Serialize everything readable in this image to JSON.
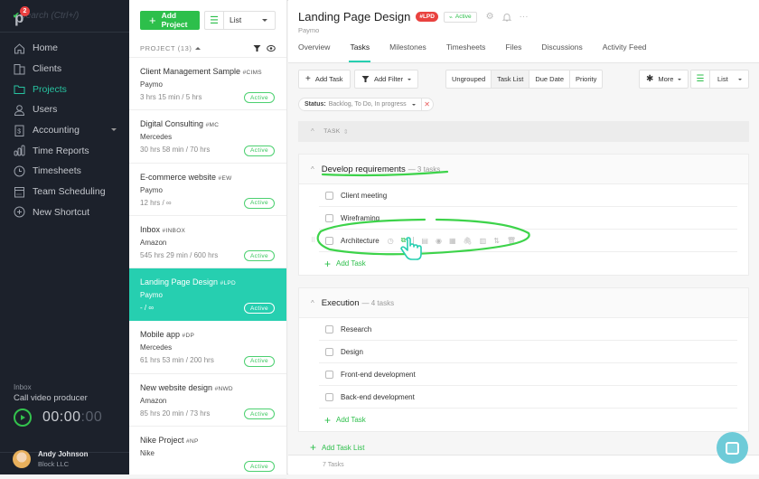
{
  "sidebar": {
    "logo": "paymo-logo",
    "notification_count": "2",
    "search_placeholder": "Search (Ctrl+/)",
    "nav": [
      {
        "label": "Home",
        "icon": "home-icon"
      },
      {
        "label": "Clients",
        "icon": "clients-icon"
      },
      {
        "label": "Projects",
        "icon": "folder-icon",
        "active": true
      },
      {
        "label": "Users",
        "icon": "user-icon"
      },
      {
        "label": "Accounting",
        "icon": "accounting-icon",
        "has_dropdown": true
      },
      {
        "label": "Time Reports",
        "icon": "bar-chart-icon"
      },
      {
        "label": "Timesheets",
        "icon": "clock-icon"
      },
      {
        "label": "Team Scheduling",
        "icon": "calendar-icon"
      },
      {
        "label": "New Shortcut",
        "icon": "plus-circle-icon"
      }
    ],
    "timer": {
      "context": "Inbox",
      "task": "Call video producer",
      "time_main": "00:00",
      "time_dim": ":00"
    },
    "user": {
      "name": "Andy Johnson",
      "company": "Block LLC"
    }
  },
  "projects": {
    "add_label": "Add Project",
    "view_label": "List",
    "header": "PROJECT (13)",
    "items": [
      {
        "name": "Client Management Sample",
        "code": "#CIMS",
        "client": "Paymo",
        "time": "3 hrs 15 min / 5 hrs",
        "status": "Active"
      },
      {
        "name": "Digital Consulting",
        "code": "#MC",
        "client": "Mercedes",
        "time": "30 hrs 58 min / 70 hrs",
        "status": "Active"
      },
      {
        "name": "E-commerce website",
        "code": "#EW",
        "client": "Paymo",
        "time": "12 hrs / ∞",
        "status": "Active"
      },
      {
        "name": "Inbox",
        "code": "#INBOX",
        "client": "Amazon",
        "time": "545 hrs 29 min / 600 hrs",
        "status": "Active"
      },
      {
        "name": "Landing Page Design",
        "code": "#LPD",
        "client": "Paymo",
        "time": "- / ∞",
        "status": "Active",
        "selected": true
      },
      {
        "name": "Mobile app",
        "code": "#DP",
        "client": "Mercedes",
        "time": "61 hrs 53 min / 200 hrs",
        "status": "Active"
      },
      {
        "name": "New website design",
        "code": "#NWD",
        "client": "Amazon",
        "time": "85 hrs 20 min / 73 hrs",
        "status": "Active"
      },
      {
        "name": "Nike Project",
        "code": "#NP",
        "client": "Nike",
        "time": "",
        "status": "Active"
      }
    ]
  },
  "main": {
    "title": "Landing Page Design",
    "code": "#LPD",
    "status": "Active",
    "client": "Paymo",
    "tabs": [
      "Overview",
      "Tasks",
      "Milestones",
      "Timesheets",
      "Files",
      "Discussions",
      "Activity Feed"
    ],
    "active_tab": "Tasks",
    "toolbar": {
      "add_task": "Add Task",
      "add_filter": "Add Filter",
      "grouping": [
        "Ungrouped",
        "Task List",
        "Due Date",
        "Priority"
      ],
      "grouping_active": "Task List",
      "more": "More",
      "view": "List"
    },
    "filter": {
      "label": "Status:",
      "value": "Backlog, To Do, In progress"
    },
    "column_header": "TASK",
    "task_lists": [
      {
        "name": "Develop requirements",
        "count": "— 3 tasks",
        "tasks": [
          "Client meeting",
          "Wireframing",
          "Architecture"
        ],
        "add_label": "Add Task"
      },
      {
        "name": "Execution",
        "count": "— 4 tasks",
        "tasks": [
          "Research",
          "Design",
          "Front-end development",
          "Back-end development"
        ],
        "add_label": "Add Task"
      }
    ],
    "add_task_list": "Add Task List",
    "footer": "7 Tasks"
  },
  "colors": {
    "accent_teal": "#26cfb0",
    "green": "#2dbf4b",
    "sidebar_bg": "#1c212b",
    "red_badge": "#e9423f"
  }
}
